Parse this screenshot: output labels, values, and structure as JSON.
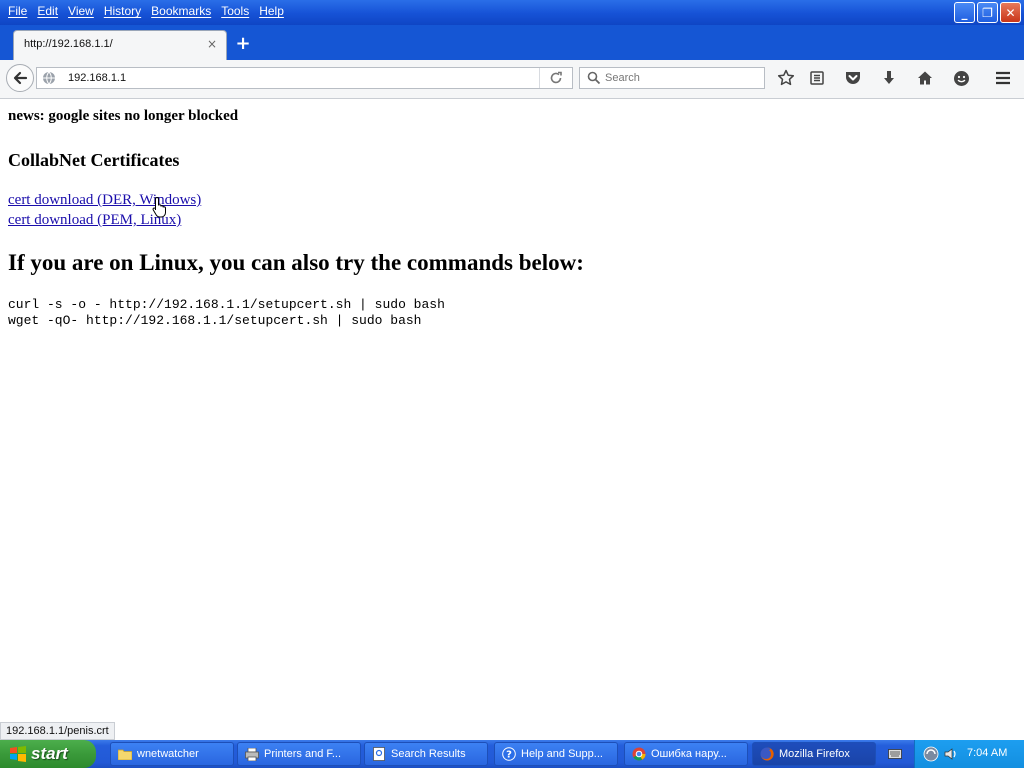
{
  "menu": [
    "File",
    "Edit",
    "View",
    "History",
    "Bookmarks",
    "Tools",
    "Help"
  ],
  "window_buttons": {
    "minimize": "_",
    "restore": "❐",
    "close": "✕"
  },
  "tab": {
    "title": "http://192.168.1.1/",
    "close": "×"
  },
  "new_tab": "+",
  "nav": {
    "url": "192.168.1.1",
    "search_placeholder": "Search"
  },
  "page": {
    "news": "news: google sites no longer blocked",
    "cert_heading": "CollabNet Certificates",
    "link_der": "cert download (DER, Windows)",
    "link_pem": "cert download (PEM, Linux)",
    "linux_heading": "If you are on Linux, you can also try the commands below:",
    "cmd_curl": "curl -s -o - http://192.168.1.1/setupcert.sh | sudo bash",
    "cmd_wget": "wget -qO- http://192.168.1.1/setupcert.sh | sudo bash"
  },
  "status": "192.168.1.1/penis.crt",
  "taskbar": {
    "start": "start",
    "tasks": [
      {
        "label": "wnetwatcher",
        "icon": "folder-icon"
      },
      {
        "label": "Printers and F...",
        "icon": "printer-icon"
      },
      {
        "label": "Search Results",
        "icon": "search-results-icon"
      },
      {
        "label": "Help and Supp...",
        "icon": "help-icon"
      },
      {
        "label": "Ошибка нару...",
        "icon": "chrome-icon"
      },
      {
        "label": "Mozilla Firefox",
        "icon": "firefox-icon"
      }
    ],
    "time": "7:04 AM"
  },
  "colors": {
    "titlebar": "#1652d6",
    "link": "#1a0dab",
    "start_green": "#3a9a3a",
    "tray": "#138fe0"
  }
}
